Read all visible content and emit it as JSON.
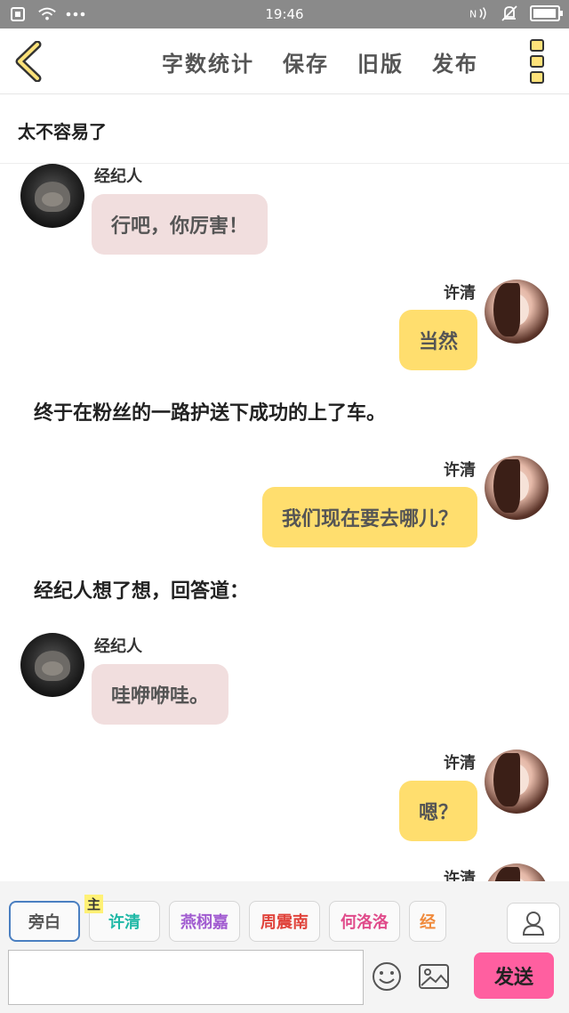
{
  "status_bar": {
    "time": "19:46",
    "battery_level": 0.95
  },
  "header": {
    "menu": [
      {
        "label": "字数统计"
      },
      {
        "label": "保存"
      },
      {
        "label": "旧版"
      },
      {
        "label": "发布"
      }
    ]
  },
  "story": {
    "title": "太不容易了"
  },
  "chat": {
    "messages": [
      {
        "type": "left",
        "name": "经纪人",
        "text": "行吧，你厉害！"
      },
      {
        "type": "right",
        "name": "许清",
        "text": "当然"
      },
      {
        "type": "narration",
        "text": "终于在粉丝的一路护送下成功的上了车。"
      },
      {
        "type": "right",
        "name": "许清",
        "text": "我们现在要去哪儿？"
      },
      {
        "type": "narration",
        "text": "经纪人想了想，回答道："
      },
      {
        "type": "left",
        "name": "经纪人",
        "text": "哇咿咿哇。"
      },
      {
        "type": "right",
        "name": "许清",
        "text": "嗯？"
      },
      {
        "type": "right",
        "name": "许清",
        "text": ""
      }
    ]
  },
  "roles": [
    {
      "label": "旁白",
      "color": "#555555"
    },
    {
      "label": "许清",
      "color": "#1fb8a6",
      "tag": "主"
    },
    {
      "label": "燕栩嘉",
      "color": "#a05ad0"
    },
    {
      "label": "周震南",
      "color": "#e0433b"
    },
    {
      "label": "何洛洛",
      "color": "#e04a8a"
    },
    {
      "label": "经",
      "color": "#f08a3b"
    }
  ],
  "composer": {
    "input_value": "",
    "send_label": "发送"
  }
}
